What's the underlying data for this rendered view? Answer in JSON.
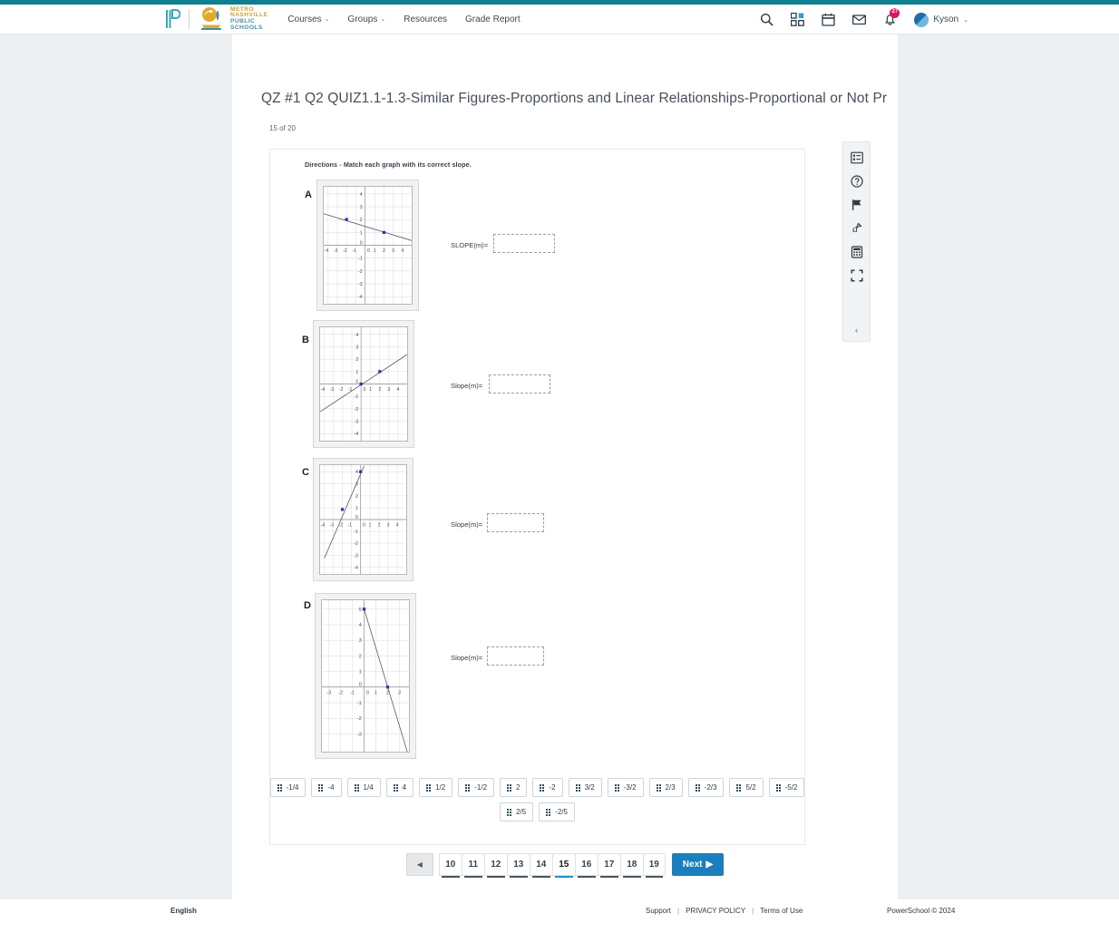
{
  "theme": {
    "accent": "#1b7fbd",
    "brand_teal": "#0d7f8f",
    "badge_red": "#e0115f"
  },
  "header": {
    "brand": {
      "powerschool_logo": "powerschool-p-logo",
      "district_lines": [
        "METRO",
        "NASHVILLE",
        "PUBLIC",
        "SCHOOLS"
      ]
    },
    "nav": [
      {
        "label": "Courses",
        "caret": "⌄"
      },
      {
        "label": "Groups",
        "caret": "⌄"
      },
      {
        "label": "Resources",
        "caret": ""
      },
      {
        "label": "Grade Report",
        "caret": ""
      }
    ],
    "icons": [
      {
        "name": "search-icon"
      },
      {
        "name": "apps-grid-icon"
      },
      {
        "name": "calendar-icon"
      },
      {
        "name": "mail-icon"
      },
      {
        "name": "notifications-bell-icon",
        "badge": "27"
      }
    ],
    "user": {
      "name": "Kyson",
      "caret": "⌄"
    }
  },
  "quiz": {
    "title": "QZ #1 Q2 QUIZ1.1-1.3-Similar Figures-Proportions and Linear Relationships-Proportional or Not Pr...",
    "progress": "15 of 20",
    "directions": "Directions - Match each graph with its correct slope."
  },
  "chart_data": [
    {
      "type": "line",
      "title": "A",
      "xlabel": "",
      "ylabel": "",
      "xlim": [
        -4.5,
        4.5
      ],
      "ylim": [
        -4.5,
        4.5
      ],
      "xticks": [
        -4,
        -3,
        -2,
        -1,
        0,
        1,
        2,
        3,
        4
      ],
      "yticks": [
        -4,
        -3,
        -2,
        -1,
        0,
        1,
        2,
        3,
        4
      ],
      "grid": true,
      "points": [
        [
          -2,
          2
        ],
        [
          2,
          1
        ]
      ],
      "line": {
        "slope": -0.25,
        "intercept": 1.5
      },
      "answer": "-1/4"
    },
    {
      "type": "line",
      "title": "B",
      "xlabel": "",
      "ylabel": "",
      "xlim": [
        -4.5,
        4.5
      ],
      "ylim": [
        -4.5,
        4.5
      ],
      "xticks": [
        -4,
        -3,
        -2,
        -1,
        0,
        1,
        2,
        3,
        4
      ],
      "yticks": [
        -4,
        -3,
        -2,
        -1,
        0,
        1,
        2,
        3,
        4
      ],
      "grid": true,
      "points": [
        [
          0,
          0
        ],
        [
          2,
          1
        ]
      ],
      "line": {
        "slope": 0.5,
        "intercept": 0
      },
      "answer": "1/2"
    },
    {
      "type": "line",
      "title": "C",
      "xlabel": "",
      "ylabel": "",
      "xlim": [
        -4.5,
        4.5
      ],
      "ylim": [
        -4.5,
        4.5
      ],
      "xticks": [
        -4,
        -3,
        -2,
        -1,
        0,
        1,
        2,
        3,
        4
      ],
      "yticks": [
        -4,
        -3,
        -2,
        -1,
        0,
        1,
        2,
        3,
        4
      ],
      "grid": true,
      "points": [
        [
          -2,
          1
        ],
        [
          0,
          4
        ]
      ],
      "line": {
        "slope": 1.5,
        "intercept": 4
      },
      "answer": "3/2"
    },
    {
      "type": "line",
      "title": "D",
      "xlabel": "",
      "ylabel": "",
      "xlim": [
        -3.5,
        3.5
      ],
      "ylim": [
        -3.5,
        5.5
      ],
      "xticks": [
        -3,
        -2,
        -1,
        0,
        1,
        2,
        3
      ],
      "yticks": [
        -3,
        -2,
        -1,
        0,
        1,
        2,
        3,
        4,
        5
      ],
      "grid": true,
      "points": [
        [
          0,
          5
        ],
        [
          2,
          0
        ]
      ],
      "line": {
        "slope": -2.5,
        "intercept": 5
      },
      "answer": "-5/2"
    }
  ],
  "graphs": [
    {
      "letter": "A",
      "slope_label": "SLOPE(m)=",
      "dropzone_value": ""
    },
    {
      "letter": "B",
      "slope_label": "Slope(m)=",
      "dropzone_value": ""
    },
    {
      "letter": "C",
      "slope_label": "Slope(m)=",
      "dropzone_value": ""
    },
    {
      "letter": "D",
      "slope_label": "Slope(m)=",
      "dropzone_value": ""
    }
  ],
  "answer_tiles": {
    "row1": [
      "-1/4",
      "-4",
      "1/4",
      "4",
      "1/2",
      "-1/2",
      "2",
      "-2",
      "3/2",
      "-3/2",
      "2/3",
      "-2/3",
      "5/2",
      "-5/2"
    ],
    "row2": [
      "2/5",
      "-2/5"
    ]
  },
  "pagination": {
    "back_glyph": "◀",
    "pages": [
      "10",
      "11",
      "12",
      "13",
      "14",
      "15",
      "16",
      "17",
      "18",
      "19"
    ],
    "active": "15",
    "next_label": "Next",
    "next_glyph": "▶"
  },
  "toolrail": {
    "tools": [
      {
        "name": "outline-list-icon"
      },
      {
        "name": "help-circle-icon"
      },
      {
        "name": "flag-icon"
      },
      {
        "name": "highlighter-pen-icon"
      },
      {
        "name": "calculator-icon"
      },
      {
        "name": "fullscreen-icon"
      }
    ],
    "collapse_glyph": "‹"
  },
  "footer": {
    "language": "English",
    "links": [
      "Support",
      "PRIVACY POLICY",
      "Terms of Use"
    ],
    "separator": "|",
    "copyright": "PowerSchool © 2024"
  }
}
